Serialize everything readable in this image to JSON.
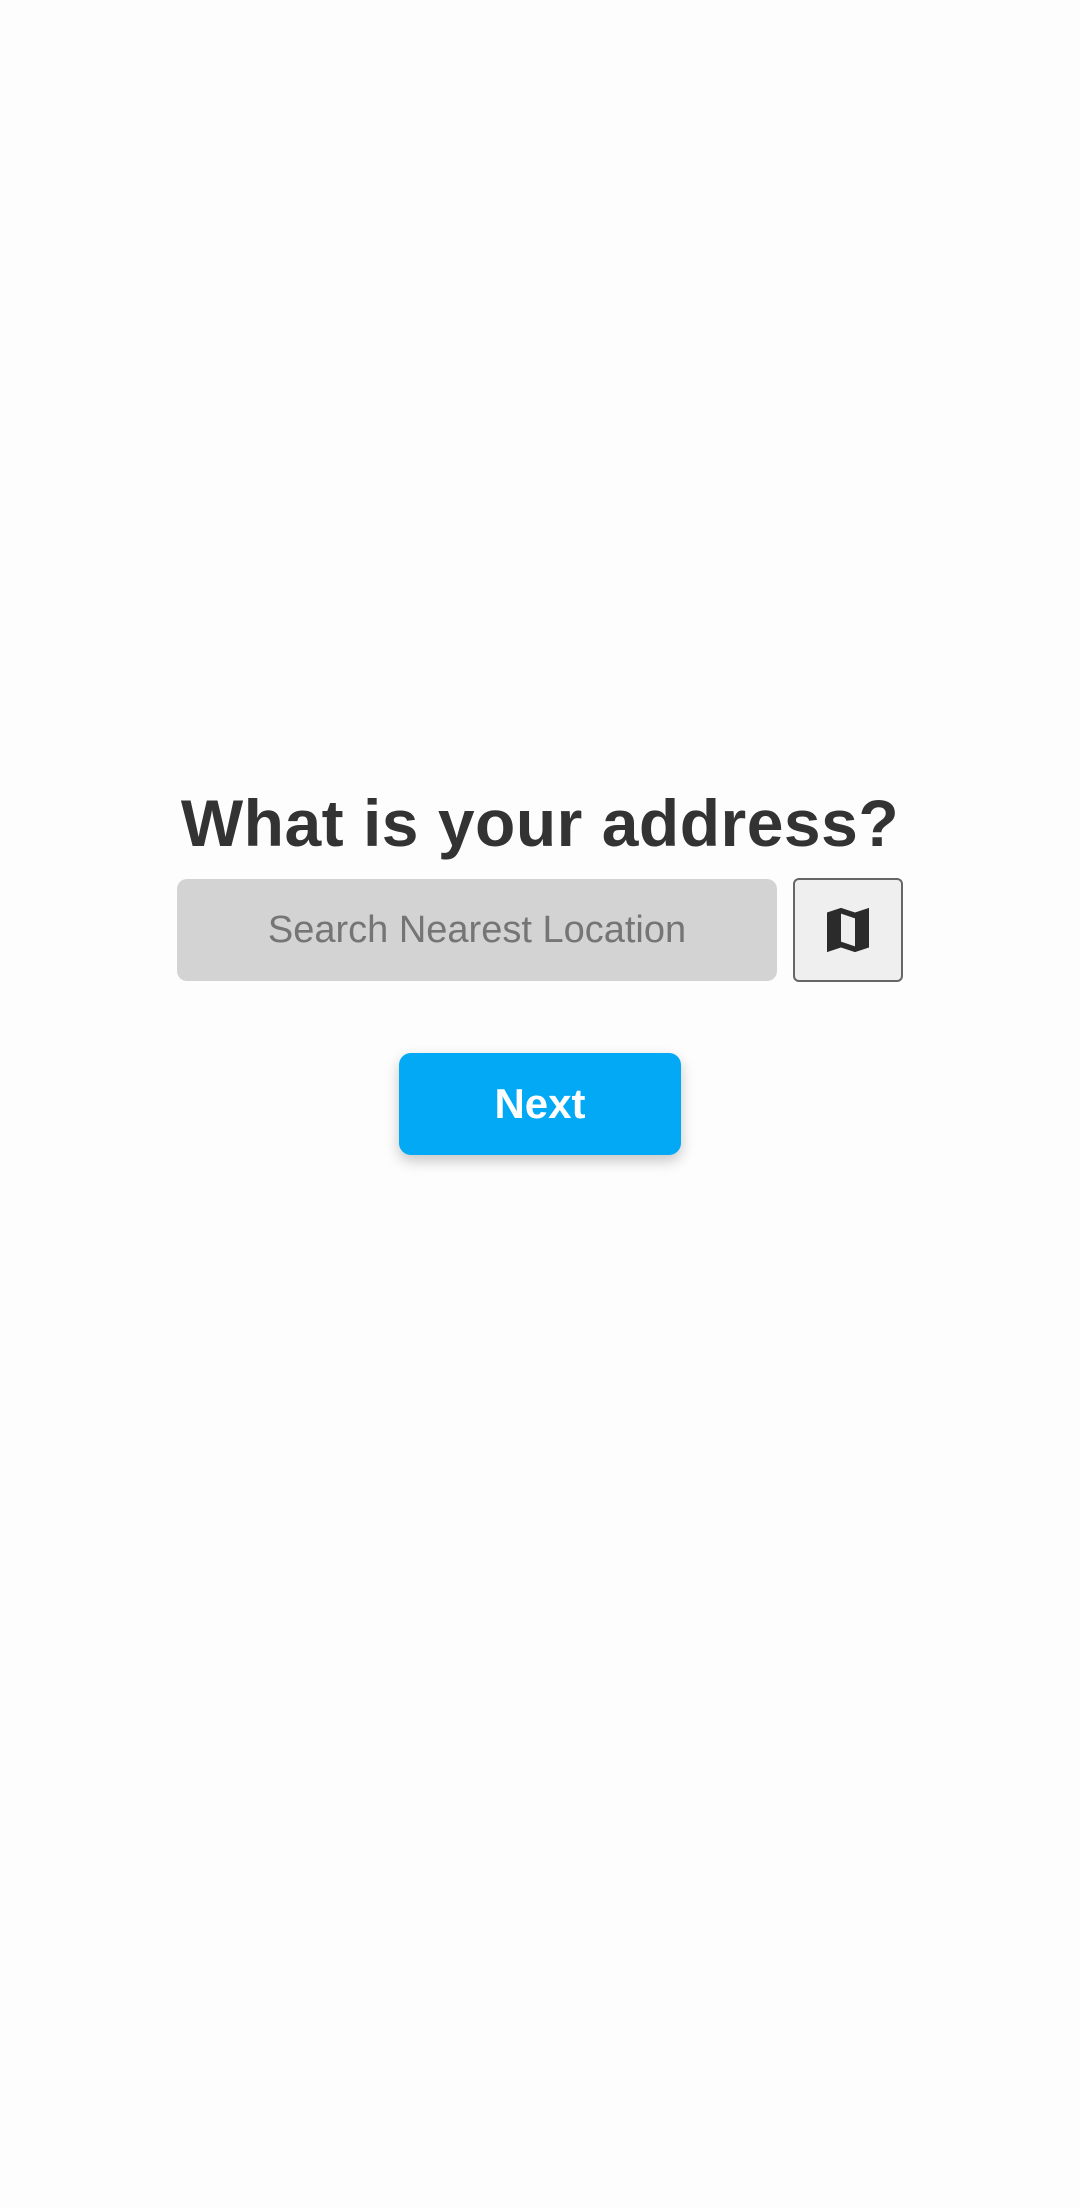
{
  "page": {
    "title": "What is your address?"
  },
  "search": {
    "placeholder": "Search Nearest Location",
    "value": ""
  },
  "map_button": {
    "icon": "map-icon"
  },
  "next_button": {
    "label": "Next",
    "color": "#03a9f4"
  }
}
